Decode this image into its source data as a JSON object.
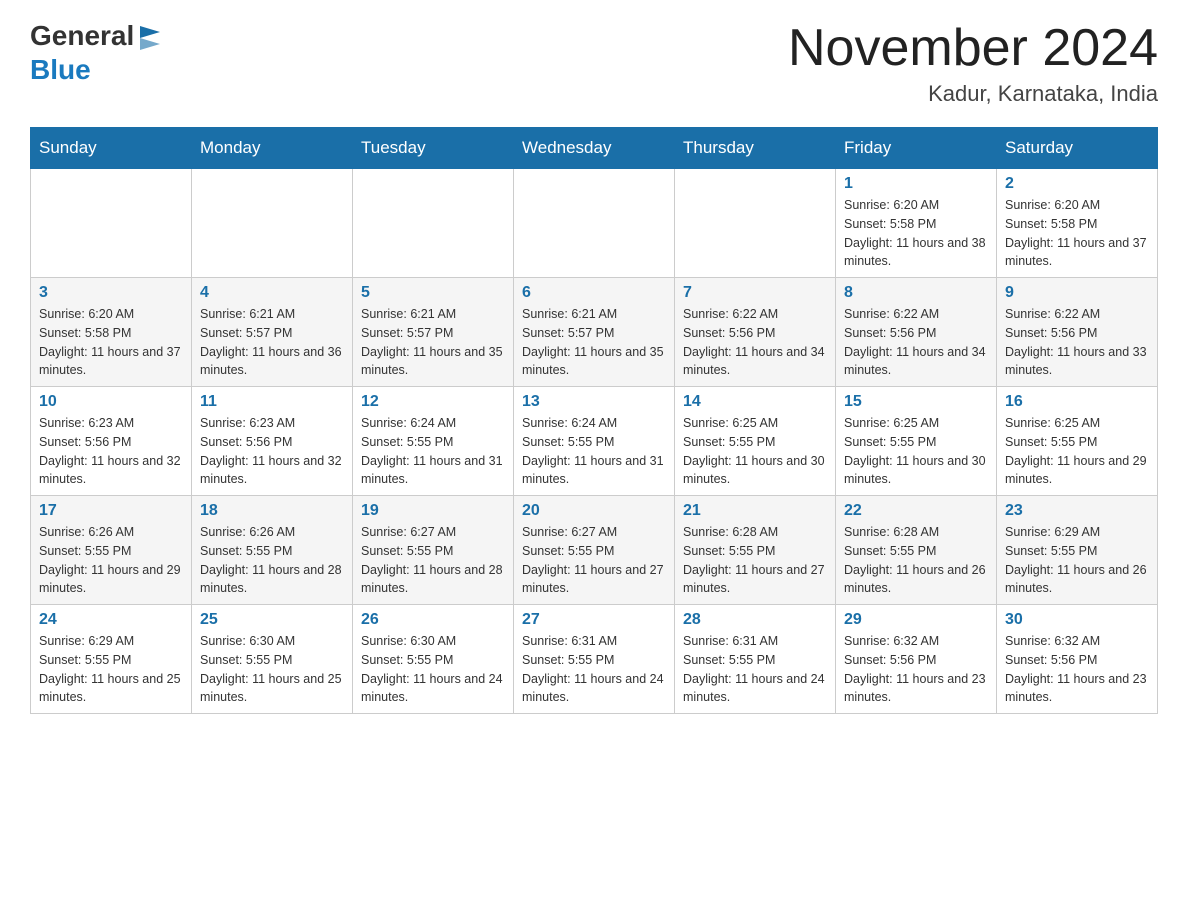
{
  "header": {
    "logo_general": "General",
    "logo_blue": "Blue",
    "month_title": "November 2024",
    "location": "Kadur, Karnataka, India"
  },
  "days_of_week": [
    "Sunday",
    "Monday",
    "Tuesday",
    "Wednesday",
    "Thursday",
    "Friday",
    "Saturday"
  ],
  "weeks": [
    [
      {
        "day": "",
        "info": ""
      },
      {
        "day": "",
        "info": ""
      },
      {
        "day": "",
        "info": ""
      },
      {
        "day": "",
        "info": ""
      },
      {
        "day": "",
        "info": ""
      },
      {
        "day": "1",
        "info": "Sunrise: 6:20 AM\nSunset: 5:58 PM\nDaylight: 11 hours and 38 minutes."
      },
      {
        "day": "2",
        "info": "Sunrise: 6:20 AM\nSunset: 5:58 PM\nDaylight: 11 hours and 37 minutes."
      }
    ],
    [
      {
        "day": "3",
        "info": "Sunrise: 6:20 AM\nSunset: 5:58 PM\nDaylight: 11 hours and 37 minutes."
      },
      {
        "day": "4",
        "info": "Sunrise: 6:21 AM\nSunset: 5:57 PM\nDaylight: 11 hours and 36 minutes."
      },
      {
        "day": "5",
        "info": "Sunrise: 6:21 AM\nSunset: 5:57 PM\nDaylight: 11 hours and 35 minutes."
      },
      {
        "day": "6",
        "info": "Sunrise: 6:21 AM\nSunset: 5:57 PM\nDaylight: 11 hours and 35 minutes."
      },
      {
        "day": "7",
        "info": "Sunrise: 6:22 AM\nSunset: 5:56 PM\nDaylight: 11 hours and 34 minutes."
      },
      {
        "day": "8",
        "info": "Sunrise: 6:22 AM\nSunset: 5:56 PM\nDaylight: 11 hours and 34 minutes."
      },
      {
        "day": "9",
        "info": "Sunrise: 6:22 AM\nSunset: 5:56 PM\nDaylight: 11 hours and 33 minutes."
      }
    ],
    [
      {
        "day": "10",
        "info": "Sunrise: 6:23 AM\nSunset: 5:56 PM\nDaylight: 11 hours and 32 minutes."
      },
      {
        "day": "11",
        "info": "Sunrise: 6:23 AM\nSunset: 5:56 PM\nDaylight: 11 hours and 32 minutes."
      },
      {
        "day": "12",
        "info": "Sunrise: 6:24 AM\nSunset: 5:55 PM\nDaylight: 11 hours and 31 minutes."
      },
      {
        "day": "13",
        "info": "Sunrise: 6:24 AM\nSunset: 5:55 PM\nDaylight: 11 hours and 31 minutes."
      },
      {
        "day": "14",
        "info": "Sunrise: 6:25 AM\nSunset: 5:55 PM\nDaylight: 11 hours and 30 minutes."
      },
      {
        "day": "15",
        "info": "Sunrise: 6:25 AM\nSunset: 5:55 PM\nDaylight: 11 hours and 30 minutes."
      },
      {
        "day": "16",
        "info": "Sunrise: 6:25 AM\nSunset: 5:55 PM\nDaylight: 11 hours and 29 minutes."
      }
    ],
    [
      {
        "day": "17",
        "info": "Sunrise: 6:26 AM\nSunset: 5:55 PM\nDaylight: 11 hours and 29 minutes."
      },
      {
        "day": "18",
        "info": "Sunrise: 6:26 AM\nSunset: 5:55 PM\nDaylight: 11 hours and 28 minutes."
      },
      {
        "day": "19",
        "info": "Sunrise: 6:27 AM\nSunset: 5:55 PM\nDaylight: 11 hours and 28 minutes."
      },
      {
        "day": "20",
        "info": "Sunrise: 6:27 AM\nSunset: 5:55 PM\nDaylight: 11 hours and 27 minutes."
      },
      {
        "day": "21",
        "info": "Sunrise: 6:28 AM\nSunset: 5:55 PM\nDaylight: 11 hours and 27 minutes."
      },
      {
        "day": "22",
        "info": "Sunrise: 6:28 AM\nSunset: 5:55 PM\nDaylight: 11 hours and 26 minutes."
      },
      {
        "day": "23",
        "info": "Sunrise: 6:29 AM\nSunset: 5:55 PM\nDaylight: 11 hours and 26 minutes."
      }
    ],
    [
      {
        "day": "24",
        "info": "Sunrise: 6:29 AM\nSunset: 5:55 PM\nDaylight: 11 hours and 25 minutes."
      },
      {
        "day": "25",
        "info": "Sunrise: 6:30 AM\nSunset: 5:55 PM\nDaylight: 11 hours and 25 minutes."
      },
      {
        "day": "26",
        "info": "Sunrise: 6:30 AM\nSunset: 5:55 PM\nDaylight: 11 hours and 24 minutes."
      },
      {
        "day": "27",
        "info": "Sunrise: 6:31 AM\nSunset: 5:55 PM\nDaylight: 11 hours and 24 minutes."
      },
      {
        "day": "28",
        "info": "Sunrise: 6:31 AM\nSunset: 5:55 PM\nDaylight: 11 hours and 24 minutes."
      },
      {
        "day": "29",
        "info": "Sunrise: 6:32 AM\nSunset: 5:56 PM\nDaylight: 11 hours and 23 minutes."
      },
      {
        "day": "30",
        "info": "Sunrise: 6:32 AM\nSunset: 5:56 PM\nDaylight: 11 hours and 23 minutes."
      }
    ]
  ]
}
